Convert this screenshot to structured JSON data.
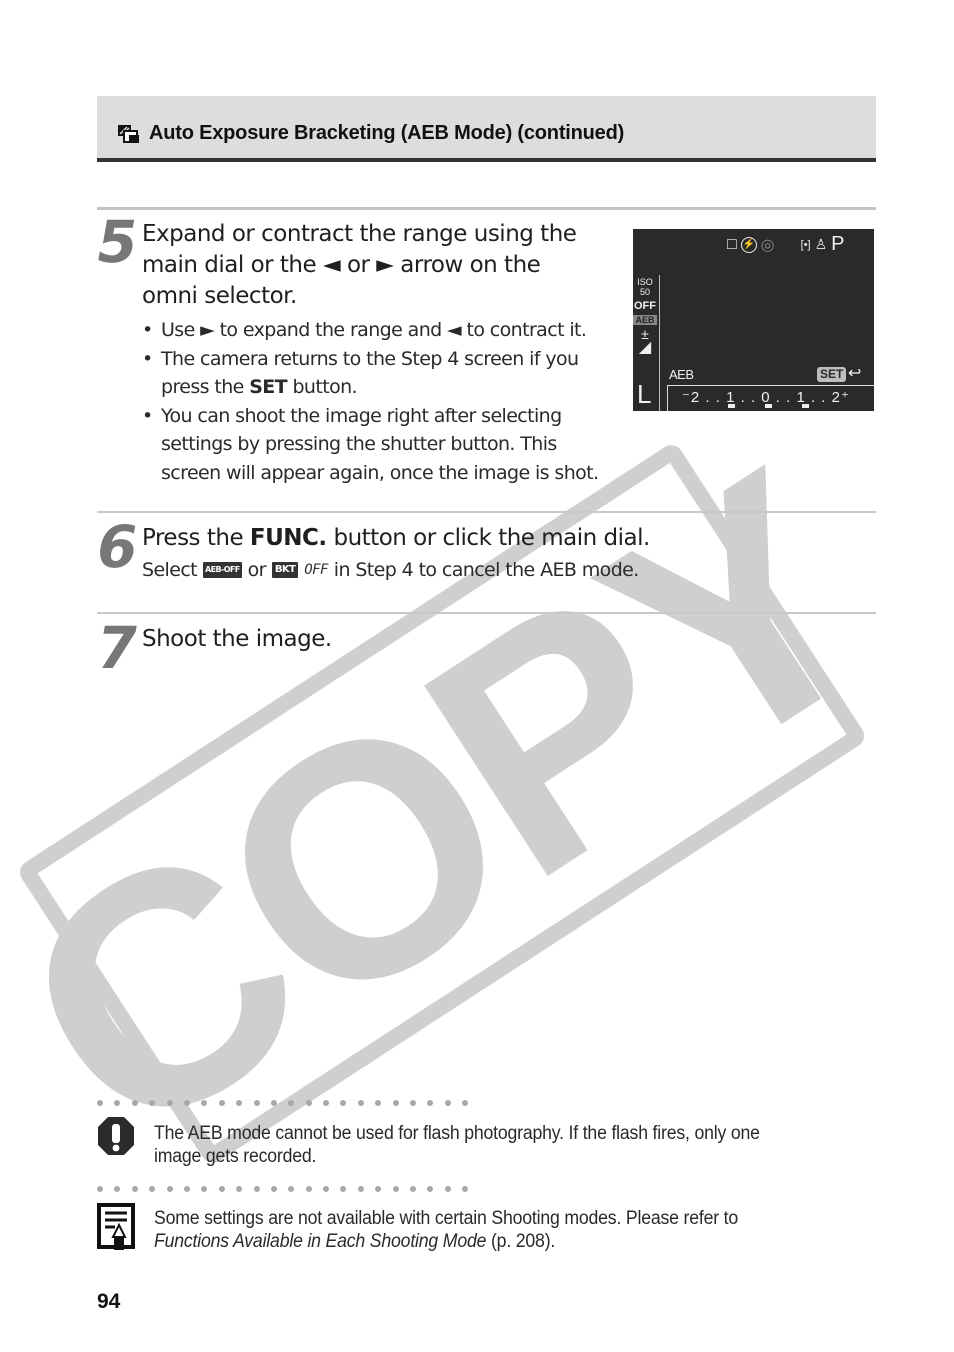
{
  "header": {
    "icon": "aeb-bracketing-icon",
    "title": "Auto Exposure Bracketing (AEB Mode) (continued)"
  },
  "steps": [
    {
      "number": "5",
      "title_parts": [
        "Expand or contract the range using the",
        "main dial or the ◄ or ► arrow on the",
        "omni selector."
      ],
      "bullets": [
        {
          "lines": [
            "Use ► to expand the range and ◄ to contract it."
          ]
        },
        {
          "lines": [
            "The camera returns to the Step 4 screen if you"
          ],
          "line2_pre": "press the ",
          "line2_bold": "SET",
          "line2_post": " button."
        },
        {
          "lines": [
            "You can shoot the image right after selecting",
            "settings by pressing the shutter button. This",
            "screen will appear again, once the image is shot."
          ]
        }
      ],
      "bullet_char": "•"
    },
    {
      "number": "6",
      "title_pre": "Press the ",
      "title_bold": "FUNC.",
      "title_post": " button or click the main dial.",
      "sub_pre": "Select",
      "sub_icon1": "AEB-OFF",
      "sub_or": "or",
      "sub_icon2": "BKT",
      "sub_off": "OFF",
      "sub_post": "in Step 4 to cancel the AEB mode."
    },
    {
      "number": "7",
      "title": "Shoot the image."
    }
  ],
  "lcd": {
    "top_icons": [
      "□",
      "⚡",
      "◎",
      "[•]",
      "♙",
      "P"
    ],
    "mode": "P",
    "sidebar": [
      "ISO 50",
      "OFF",
      "AEB",
      "±",
      "◢"
    ],
    "size_label": "L",
    "aeb_label": "AEB",
    "set_label": "SET",
    "return_icon": "↩",
    "scale": "⁻2 . . 1 . . 0 . . 1 . . 2⁺",
    "scale_values": [
      -2,
      -1,
      0,
      1,
      2
    ],
    "selected_bracket_marks": [
      -1,
      0,
      1
    ]
  },
  "notes": [
    {
      "icon": "caution-icon",
      "text": "The AEB mode cannot be used for flash photography. If the flash fires, only one image gets recorded."
    },
    {
      "icon": "memo-icon",
      "text_pre": "Some settings are not available with certain Shooting modes. Please refer to ",
      "text_italic": "Functions Available in Each Shooting Mode",
      "text_post": " (p. 208)."
    }
  ],
  "watermark": "COPY",
  "page_number": "94"
}
